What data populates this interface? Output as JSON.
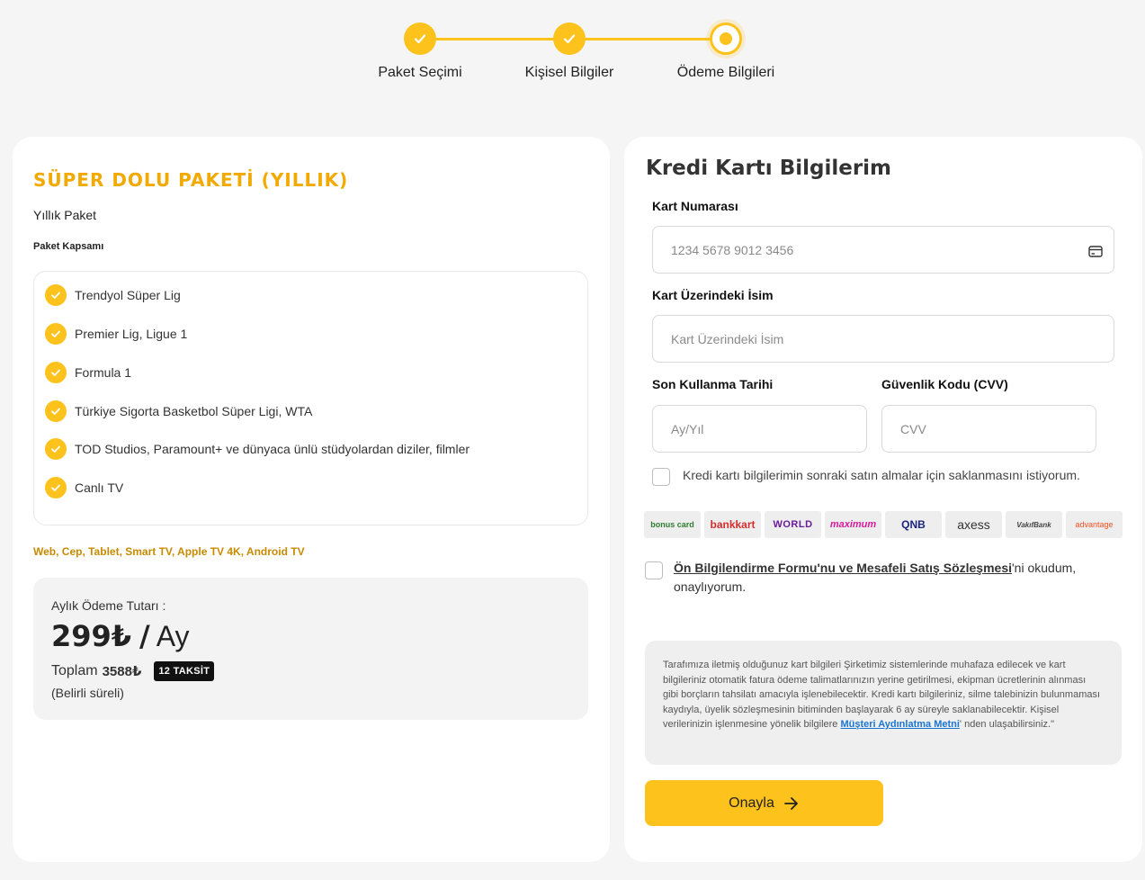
{
  "stepper": {
    "steps": [
      {
        "label": "Paket Seçimi",
        "state": "done"
      },
      {
        "label": "Kişisel Bilgiler",
        "state": "done"
      },
      {
        "label": "Ödeme Bilgileri",
        "state": "current"
      }
    ],
    "accent_color": "#fdc21b"
  },
  "package": {
    "title": "SÜPER DOLU PAKETİ (YILLIK)",
    "subtitle": "Yıllık Paket",
    "scope_label": "Paket Kapsamı",
    "features": [
      "Trendyol Süper Lig",
      "Premier Lig, Ligue 1",
      "Formula 1",
      "Türkiye Sigorta Basketbol Süper Ligi, WTA",
      "TOD Studios, Paramount+ ve dünyaca ünlü stüdyolardan diziler, filmler",
      "Canlı TV"
    ],
    "devices": "Web, Cep, Tablet, Smart TV, Apple TV 4K, Android TV",
    "price": {
      "label": "Aylık Ödeme Tutarı :",
      "amount": "299₺",
      "separator": "/",
      "period": "Ay",
      "total_label": "Toplam",
      "total_value": "3588₺",
      "installment_badge": "12 TAKSİT",
      "note": "(Belirli süreli)"
    }
  },
  "payment": {
    "title": "Kredi Kartı Bilgilerim",
    "card_number": {
      "label": "Kart Numarası",
      "placeholder": "1234 5678 9012 3456"
    },
    "card_name": {
      "label": "Kart Üzerindeki İsim",
      "placeholder": "Kart Üzerindeki İsim"
    },
    "expiry": {
      "label": "Son Kullanma Tarihi",
      "placeholder": "Ay/Yıl"
    },
    "cvv": {
      "label": "Güvenlik Kodu (CVV)",
      "placeholder": "CVV"
    },
    "save_card_text": "Kredi kartı bilgilerimin sonraki satın almalar için saklanmasını istiyorum.",
    "banks": [
      {
        "name": "bonus card",
        "color": "#2e7d32"
      },
      {
        "name": "bankkart",
        "color": "#d32f2f"
      },
      {
        "name": "WORLD",
        "color": "#6a1b9a"
      },
      {
        "name": "maximum",
        "color": "#d81b9a"
      },
      {
        "name": "QNB",
        "color": "#1a237e"
      },
      {
        "name": "axess",
        "color": "#333333"
      },
      {
        "name": "VakıfBank",
        "color": "#444444"
      },
      {
        "name": "advantage",
        "color": "#f4511e"
      }
    ],
    "agreement": {
      "link_text": "Ön Bilgilendirme Formu'nu ve Mesafeli Satış Sözleşmesi",
      "suffix": "'ni okudum, onaylıyorum."
    },
    "info": {
      "text": "Tarafımıza iletmiş olduğunuz kart bilgileri Şirketimiz sistemlerinde muhafaza edilecek ve kart bilgileriniz otomatik fatura ödeme talimatlarınızın yerine getirilmesi, ekipman ücretlerinin alınması gibi borçların tahsilatı amacıyla işlenebilecektir. Kredi kartı bilgileriniz, silme talebinizin bulunmaması kaydıyla, üyelik sözleşmesinin bitiminden başlayarak 6 ay süreyle saklanabilecektir. Kişisel verilerinizin işlenmesine yönelik bilgilere ",
      "link_text": "Müşteri Aydınlatma Metni",
      "suffix": "' nden ulaşabilirsiniz.\""
    },
    "confirm_label": "Onayla"
  }
}
